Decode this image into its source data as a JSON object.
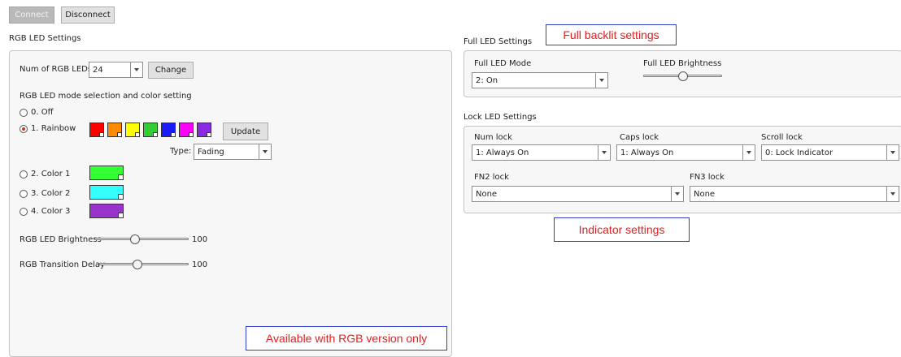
{
  "toolbar": {
    "connect_label": "Connect",
    "disconnect_label": "Disconnect"
  },
  "rgb": {
    "group_title": "RGB LED Settings",
    "num_label": "Num of RGB LEDs",
    "num_value": "24",
    "change_label": "Change",
    "mode_heading": "RGB LED mode selection and color setting",
    "modes": [
      "0. Off",
      "1. Rainbow",
      "2. Color 1",
      "3. Color 2",
      "4. Color 3"
    ],
    "selected_mode": "1. Rainbow",
    "rainbow_colors": [
      "#ff0000",
      "#ff8c00",
      "#ffff00",
      "#33cc33",
      "#1a1aff",
      "#ff00ff",
      "#8a2be2"
    ],
    "update_label": "Update",
    "type_label": "Type:",
    "type_value": "Fading",
    "color1": "#33ff33",
    "color2": "#33ffff",
    "color3": "#9933cc",
    "brightness_label": "RGB LED Brightness",
    "brightness_value": "100",
    "brightness_level": 0.42,
    "delay_label": "RGB Transition Delay",
    "delay_value": "100",
    "delay_level": 0.42
  },
  "full": {
    "group_title": "Full LED Settings",
    "mode_label": "Full LED Mode",
    "mode_value": "2: On",
    "brightness_label": "Full LED Brightness",
    "brightness_level": 0.5
  },
  "lock": {
    "group_title": "Lock LED Settings",
    "num_label": "Num lock",
    "num_value": "1: Always On",
    "caps_label": "Caps lock",
    "caps_value": "1: Always On",
    "scroll_label": "Scroll lock",
    "scroll_value": "0: Lock Indicator",
    "fn2_label": "FN2 lock",
    "fn2_value": "None",
    "fn3_label": "FN3 lock",
    "fn3_value": "None"
  },
  "annotations": {
    "full_backlit": "Full backlit settings",
    "indicator": "Indicator settings",
    "rgb_only": "Available with RGB version only"
  }
}
